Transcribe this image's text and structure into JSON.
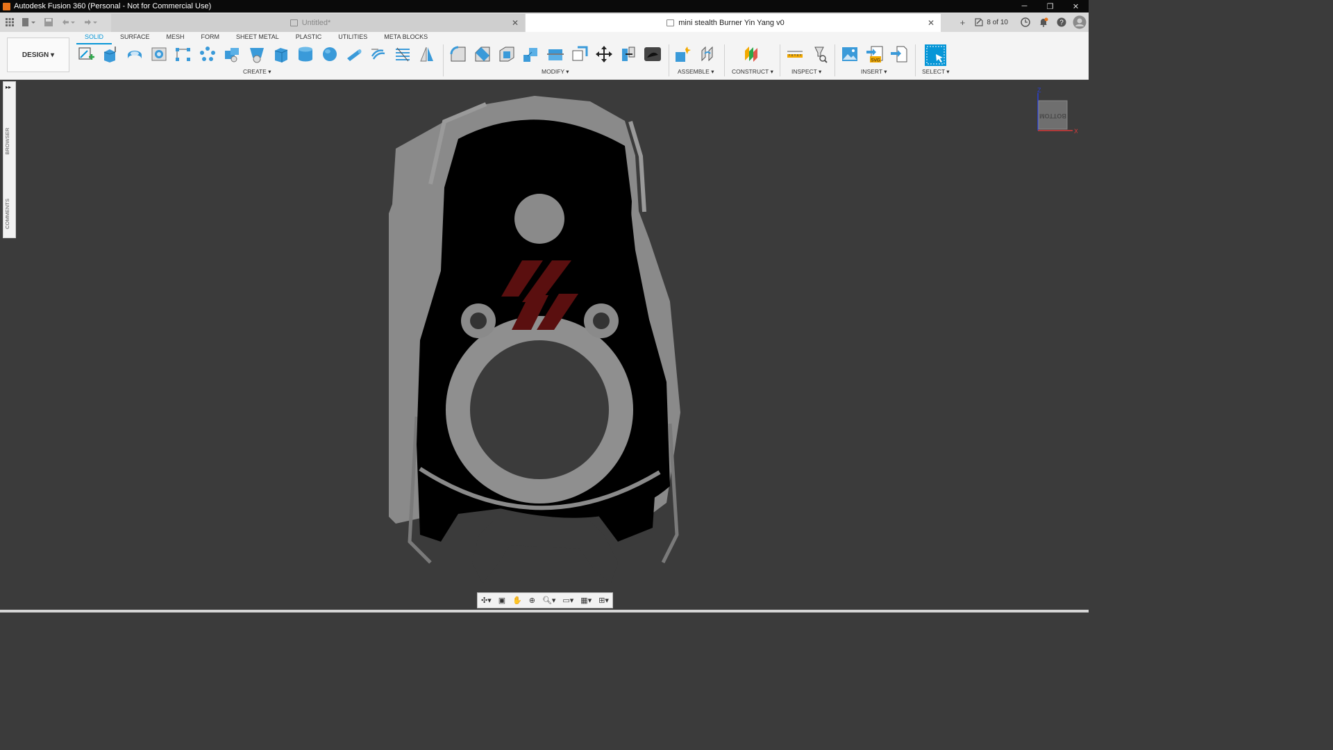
{
  "window": {
    "title": "Autodesk Fusion 360 (Personal - Not for Commercial Use)",
    "minimize": "─",
    "restore": "❐",
    "close": "✕"
  },
  "tabs": [
    {
      "title": "Untitled*",
      "active": false
    },
    {
      "title": "mini stealth Burner Yin Yang v0",
      "active": true
    }
  ],
  "job_status": "8 of 10",
  "workspace": "DESIGN",
  "ribbon_tabs": [
    "SOLID",
    "SURFACE",
    "MESH",
    "FORM",
    "SHEET METAL",
    "PLASTIC",
    "UTILITIES",
    "META BLOCKS"
  ],
  "active_ribbon_tab": "SOLID",
  "groups": {
    "create": "CREATE",
    "modify": "MODIFY",
    "assemble": "ASSEMBLE",
    "construct": "CONSTRUCT",
    "inspect": "INSPECT",
    "insert": "INSERT",
    "select": "SELECT"
  },
  "side_panel": {
    "browser": "BROWSER",
    "comments": "COMMENTS"
  },
  "viewcube": {
    "face": "BOTTOM",
    "axis_z": "Z",
    "axis_x": "X"
  },
  "colors": {
    "accent": "#0696d7",
    "viewport_bg": "#3b3b3b",
    "model_gray": "#8a8a8a",
    "model_black": "#000000",
    "logo_red": "#5a0f0f"
  }
}
